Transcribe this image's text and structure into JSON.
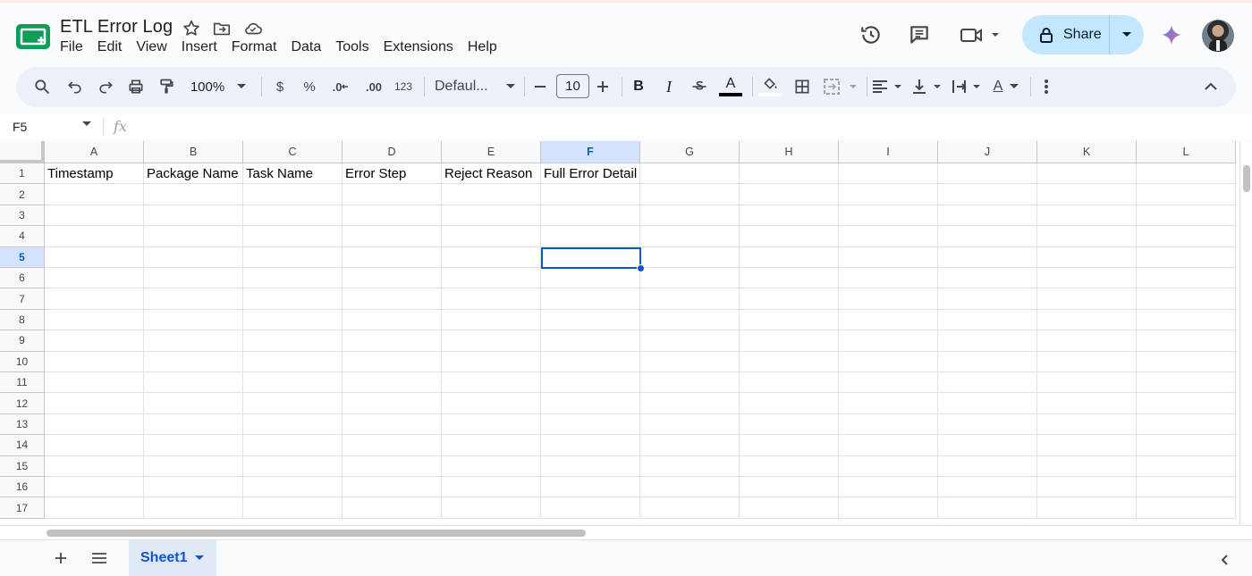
{
  "document": {
    "title": "ETL Error Log"
  },
  "menu": [
    "File",
    "Edit",
    "View",
    "Insert",
    "Format",
    "Data",
    "Tools",
    "Extensions",
    "Help"
  ],
  "header_actions": {
    "share_label": "Share"
  },
  "toolbar": {
    "zoom": "100%",
    "currency": "$",
    "percent": "%",
    "decrease_decimal": ".0",
    "increase_decimal": ".00",
    "number_format": "123",
    "font": "Defaul...",
    "font_size": "10",
    "bold": "B",
    "italic": "I",
    "text_color_letter": "A",
    "text_rotate_letter": "A"
  },
  "formula_bar": {
    "cell_ref": "F5",
    "fx": "fx",
    "content": ""
  },
  "grid": {
    "columns": [
      "A",
      "B",
      "C",
      "D",
      "E",
      "F",
      "G",
      "H",
      "I",
      "J",
      "K",
      "L"
    ],
    "rows": [
      "1",
      "2",
      "3",
      "4",
      "5",
      "6",
      "7",
      "8",
      "9",
      "10",
      "11",
      "12",
      "13",
      "14",
      "15",
      "16",
      "17"
    ],
    "header_row": [
      "Timestamp",
      "Package Name",
      "Task Name",
      "Error Step",
      "Reject Reason",
      "Full Error Detail"
    ],
    "selected_cell": {
      "column": "F",
      "row": "5"
    }
  },
  "sheets": [
    {
      "name": "Sheet1",
      "active": true
    }
  ],
  "colors": {
    "accent": "#0b57d0",
    "share_bg": "#c2e7ff",
    "toolbar_bg": "#edf2fa",
    "sheets_green": "#0f9d58"
  }
}
